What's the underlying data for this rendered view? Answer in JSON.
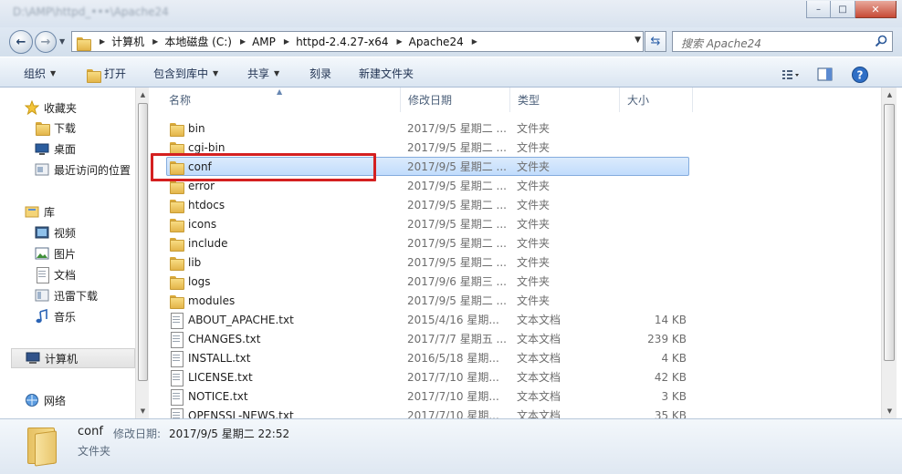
{
  "window": {
    "title": "D:\\AMP\\httpd_•••\\Apache24",
    "minimize": "–",
    "maximize": "□",
    "close": "✕"
  },
  "nav": {
    "back_glyph": "←",
    "forward_glyph": "→",
    "breadcrumbs": [
      "计算机",
      "本地磁盘 (C:)",
      "AMP",
      "httpd-2.4.27-x64",
      "Apache24"
    ],
    "search_placeholder": "搜索 Apache24"
  },
  "toolbar": {
    "organize": "组织",
    "open": "打开",
    "include_in_library": "包含到库中",
    "share": "共享",
    "burn": "刻录",
    "new_folder": "新建文件夹"
  },
  "sidebar": {
    "favorites": "收藏夹",
    "downloads": "下载",
    "desktop": "桌面",
    "recent": "最近访问的位置",
    "libraries": "库",
    "videos": "视频",
    "pictures": "图片",
    "documents": "文档",
    "thunder": "迅雷下载",
    "music": "音乐",
    "computer": "计算机",
    "network": "网络"
  },
  "columns": {
    "name": "名称",
    "date": "修改日期",
    "type": "类型",
    "size": "大小"
  },
  "files": [
    {
      "name": "bin",
      "date": "2017/9/5 星期二 ...",
      "type": "文件夹",
      "size": "",
      "kind": "folder"
    },
    {
      "name": "cgi-bin",
      "date": "2017/9/5 星期二 ...",
      "type": "文件夹",
      "size": "",
      "kind": "folder"
    },
    {
      "name": "conf",
      "date": "2017/9/5 星期二 ...",
      "type": "文件夹",
      "size": "",
      "kind": "folder"
    },
    {
      "name": "error",
      "date": "2017/9/5 星期二 ...",
      "type": "文件夹",
      "size": "",
      "kind": "folder"
    },
    {
      "name": "htdocs",
      "date": "2017/9/5 星期二 ...",
      "type": "文件夹",
      "size": "",
      "kind": "folder"
    },
    {
      "name": "icons",
      "date": "2017/9/5 星期二 ...",
      "type": "文件夹",
      "size": "",
      "kind": "folder"
    },
    {
      "name": "include",
      "date": "2017/9/5 星期二 ...",
      "type": "文件夹",
      "size": "",
      "kind": "folder"
    },
    {
      "name": "lib",
      "date": "2017/9/5 星期二 ...",
      "type": "文件夹",
      "size": "",
      "kind": "folder"
    },
    {
      "name": "logs",
      "date": "2017/9/6 星期三 ...",
      "type": "文件夹",
      "size": "",
      "kind": "folder"
    },
    {
      "name": "modules",
      "date": "2017/9/5 星期二 ...",
      "type": "文件夹",
      "size": "",
      "kind": "folder"
    },
    {
      "name": "ABOUT_APACHE.txt",
      "date": "2015/4/16 星期...",
      "type": "文本文档",
      "size": "14 KB",
      "kind": "doc"
    },
    {
      "name": "CHANGES.txt",
      "date": "2017/7/7 星期五 ...",
      "type": "文本文档",
      "size": "239 KB",
      "kind": "doc"
    },
    {
      "name": "INSTALL.txt",
      "date": "2016/5/18 星期...",
      "type": "文本文档",
      "size": "4 KB",
      "kind": "doc"
    },
    {
      "name": "LICENSE.txt",
      "date": "2017/7/10 星期...",
      "type": "文本文档",
      "size": "42 KB",
      "kind": "doc"
    },
    {
      "name": "NOTICE.txt",
      "date": "2017/7/10 星期...",
      "type": "文本文档",
      "size": "3 KB",
      "kind": "doc"
    },
    {
      "name": "OPENSSL-NEWS.txt",
      "date": "2017/7/10 星期...",
      "type": "文本文档",
      "size": "35 KB",
      "kind": "doc"
    }
  ],
  "selected_index": 2,
  "details": {
    "name": "conf",
    "modified_label": "修改日期:",
    "modified_value": "2017/9/5 星期二 22:52",
    "type": "文件夹"
  },
  "colors": {
    "selection": "#c1dcfc",
    "highlight_box": "#d42020",
    "accent": "#2b5fa8"
  }
}
